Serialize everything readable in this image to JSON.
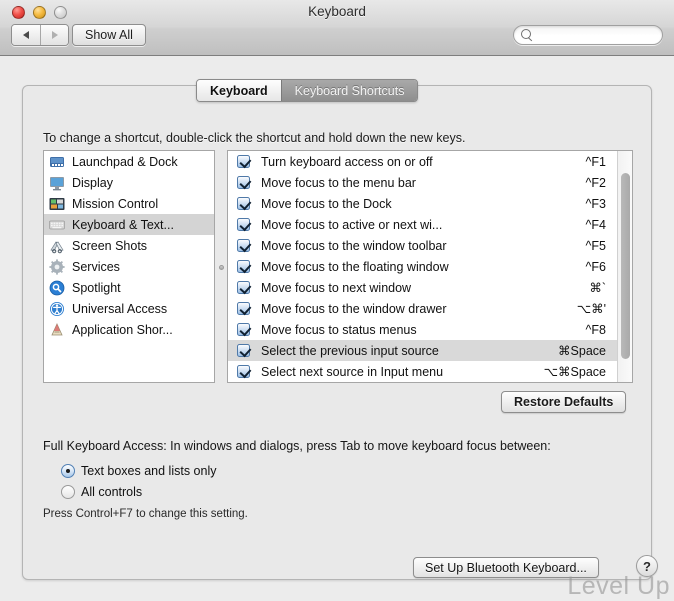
{
  "window": {
    "title": "Keyboard",
    "traffic_lights": [
      "close",
      "minimize",
      "zoom"
    ]
  },
  "toolbar": {
    "back_label": "back-arrow",
    "forward_label": "forward-arrow",
    "show_all_label": "Show All",
    "search_placeholder": "",
    "search_value": ""
  },
  "tabs": [
    {
      "label": "Keyboard",
      "active": true
    },
    {
      "label": "Keyboard Shortcuts",
      "active": false
    }
  ],
  "instruction": "To change a shortcut, double-click the shortcut and hold down the new keys.",
  "sidebar": {
    "items": [
      {
        "label": "Launchpad & Dock",
        "icon": "dock-icon",
        "selected": false
      },
      {
        "label": "Display",
        "icon": "display-icon",
        "selected": false
      },
      {
        "label": "Mission Control",
        "icon": "mission-control-icon",
        "selected": false
      },
      {
        "label": "Keyboard & Text...",
        "icon": "keyboard-icon",
        "selected": true
      },
      {
        "label": "Screen Shots",
        "icon": "screenshot-icon",
        "selected": false
      },
      {
        "label": "Services",
        "icon": "gear-icon",
        "selected": false
      },
      {
        "label": "Spotlight",
        "icon": "spotlight-icon",
        "selected": false
      },
      {
        "label": "Universal Access",
        "icon": "universal-access-icon",
        "selected": false
      },
      {
        "label": "Application Shor...",
        "icon": "application-icon",
        "selected": false
      }
    ]
  },
  "shortcuts": {
    "rows": [
      {
        "checked": true,
        "label": "Turn keyboard access on or off",
        "key": "^F1",
        "selected": false
      },
      {
        "checked": true,
        "label": "Move focus to the menu bar",
        "key": "^F2",
        "selected": false
      },
      {
        "checked": true,
        "label": "Move focus to the Dock",
        "key": "^F3",
        "selected": false
      },
      {
        "checked": true,
        "label": "Move focus to active or next wi...",
        "key": "^F4",
        "selected": false
      },
      {
        "checked": true,
        "label": "Move focus to the window toolbar",
        "key": "^F5",
        "selected": false
      },
      {
        "checked": true,
        "label": "Move focus to the floating window",
        "key": "^F6",
        "selected": false
      },
      {
        "checked": true,
        "label": "Move focus to next window",
        "key": "⌘`",
        "selected": false
      },
      {
        "checked": true,
        "label": "Move focus to the window drawer",
        "key": "⌥⌘'",
        "selected": false
      },
      {
        "checked": true,
        "label": "Move focus to status menus",
        "key": "^F8",
        "selected": false
      },
      {
        "checked": true,
        "label": "Select the previous input source",
        "key": "⌘Space",
        "selected": true
      },
      {
        "checked": true,
        "label": "Select next source in Input menu",
        "key": "⌥⌘Space",
        "selected": false
      }
    ]
  },
  "restore_defaults_label": "Restore Defaults",
  "full_keyboard_access": {
    "label": "Full Keyboard Access: In windows and dialogs, press Tab to move keyboard focus between:",
    "options": [
      {
        "label": "Text boxes and lists only",
        "selected": true
      },
      {
        "label": "All controls",
        "selected": false
      }
    ],
    "hint": "Press Control+F7 to change this setting."
  },
  "footer": {
    "bluetooth_label": "Set Up Bluetooth Keyboard...",
    "help_label": "?"
  },
  "watermark": "Level Up",
  "colors": {
    "window_bg": "#ececec",
    "panel_bg": "#e9e9e9",
    "selection": "#d9d9d9",
    "checkbox_blue": "#9dc0e6"
  }
}
